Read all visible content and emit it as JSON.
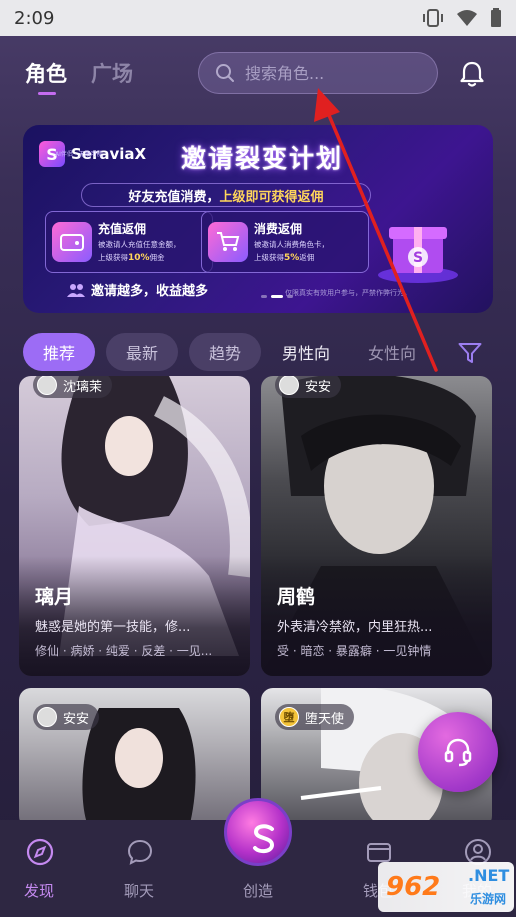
{
  "status_bar": {
    "time": "2:09"
  },
  "header": {
    "tabs": [
      {
        "label": "角色"
      },
      {
        "label": "广场"
      }
    ],
    "search": {
      "placeholder": "搜索角色..."
    }
  },
  "banner": {
    "logo_text": "SeraviaX",
    "logo_sub": "AI伴侣 · 无限可能",
    "title": "邀请裂变计划",
    "subtitle_a": "好友充值消费，",
    "subtitle_b": "上级即可获得返佣",
    "card1": {
      "title": "充值返佣",
      "desc1": "被邀请人充值任意金额，",
      "desc2a": "上级获得",
      "pct": "10%",
      "desc2b": "佣金"
    },
    "card2": {
      "title": "消费返佣",
      "desc1": "被邀请人消费角色卡，",
      "desc2a": "上级获得",
      "pct": "5%",
      "desc2b": "返佣"
    },
    "footer": "邀请越多，收益越多",
    "note": "仅限真实有效用户参与，严禁作弊行为。"
  },
  "chips": {
    "recommend": "推荐",
    "latest": "最新",
    "trend": "趋势",
    "male": "男性向",
    "female": "女性向"
  },
  "cards": [
    {
      "author": "沈璃茉",
      "name": "璃月",
      "desc": "魅惑是她的第一技能，修...",
      "tags": "修仙 · 病娇 · 纯爱 · 反差 · 一见..."
    },
    {
      "author": "安安",
      "name": "周鹤",
      "desc": "外表清冷禁欲，内里狂热...",
      "tags": "受 · 暗恋 · 暴露癖 · 一见钟情"
    },
    {
      "author": "安安"
    },
    {
      "author": "堕天使",
      "author_avatar": "堕"
    }
  ],
  "bottom_nav": {
    "discover": "发现",
    "chat": "聊天",
    "create": "创造",
    "wallet": "钱包",
    "me": "我的"
  },
  "watermark": {
    "number": "962",
    "net": ".NET",
    "sub": "乐游网"
  },
  "colors": {
    "accent": "#9c6cf5",
    "active_nav": "#c58af0",
    "annotation_arrow": "#e02020"
  }
}
